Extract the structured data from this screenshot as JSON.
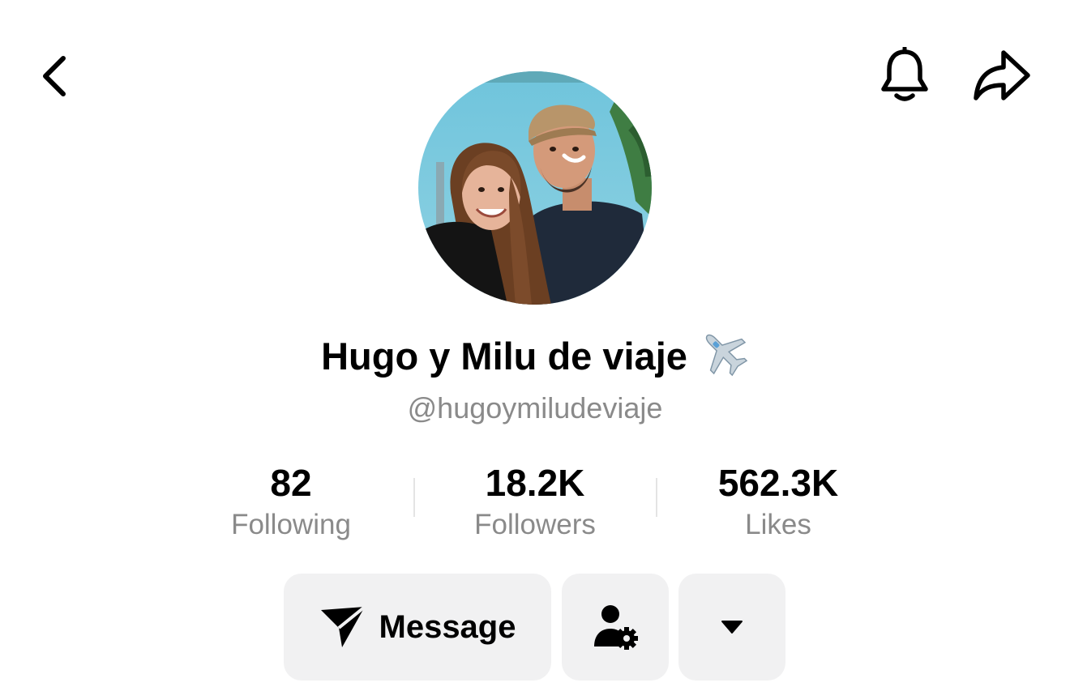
{
  "header": {
    "back_icon": "chevron-left-icon",
    "notify_icon": "bell-icon",
    "share_icon": "share-arrow-icon"
  },
  "profile": {
    "display_name": "Hugo y Milu de viaje",
    "name_emoji": "airplane-icon",
    "handle": "@hugoymiludeviaje"
  },
  "stats": [
    {
      "value": "82",
      "label": "Following"
    },
    {
      "value": "18.2K",
      "label": "Followers"
    },
    {
      "value": "562.3K",
      "label": "Likes"
    }
  ],
  "actions": {
    "message_label": "Message",
    "message_icon": "paper-plane-icon",
    "follow_settings_icon": "user-gear-icon",
    "more_icon": "caret-down-icon"
  },
  "colors": {
    "text": "#000000",
    "secondary_text": "#8a8a8a",
    "button_bg": "#f1f1f2",
    "divider": "#e4e4e4"
  }
}
